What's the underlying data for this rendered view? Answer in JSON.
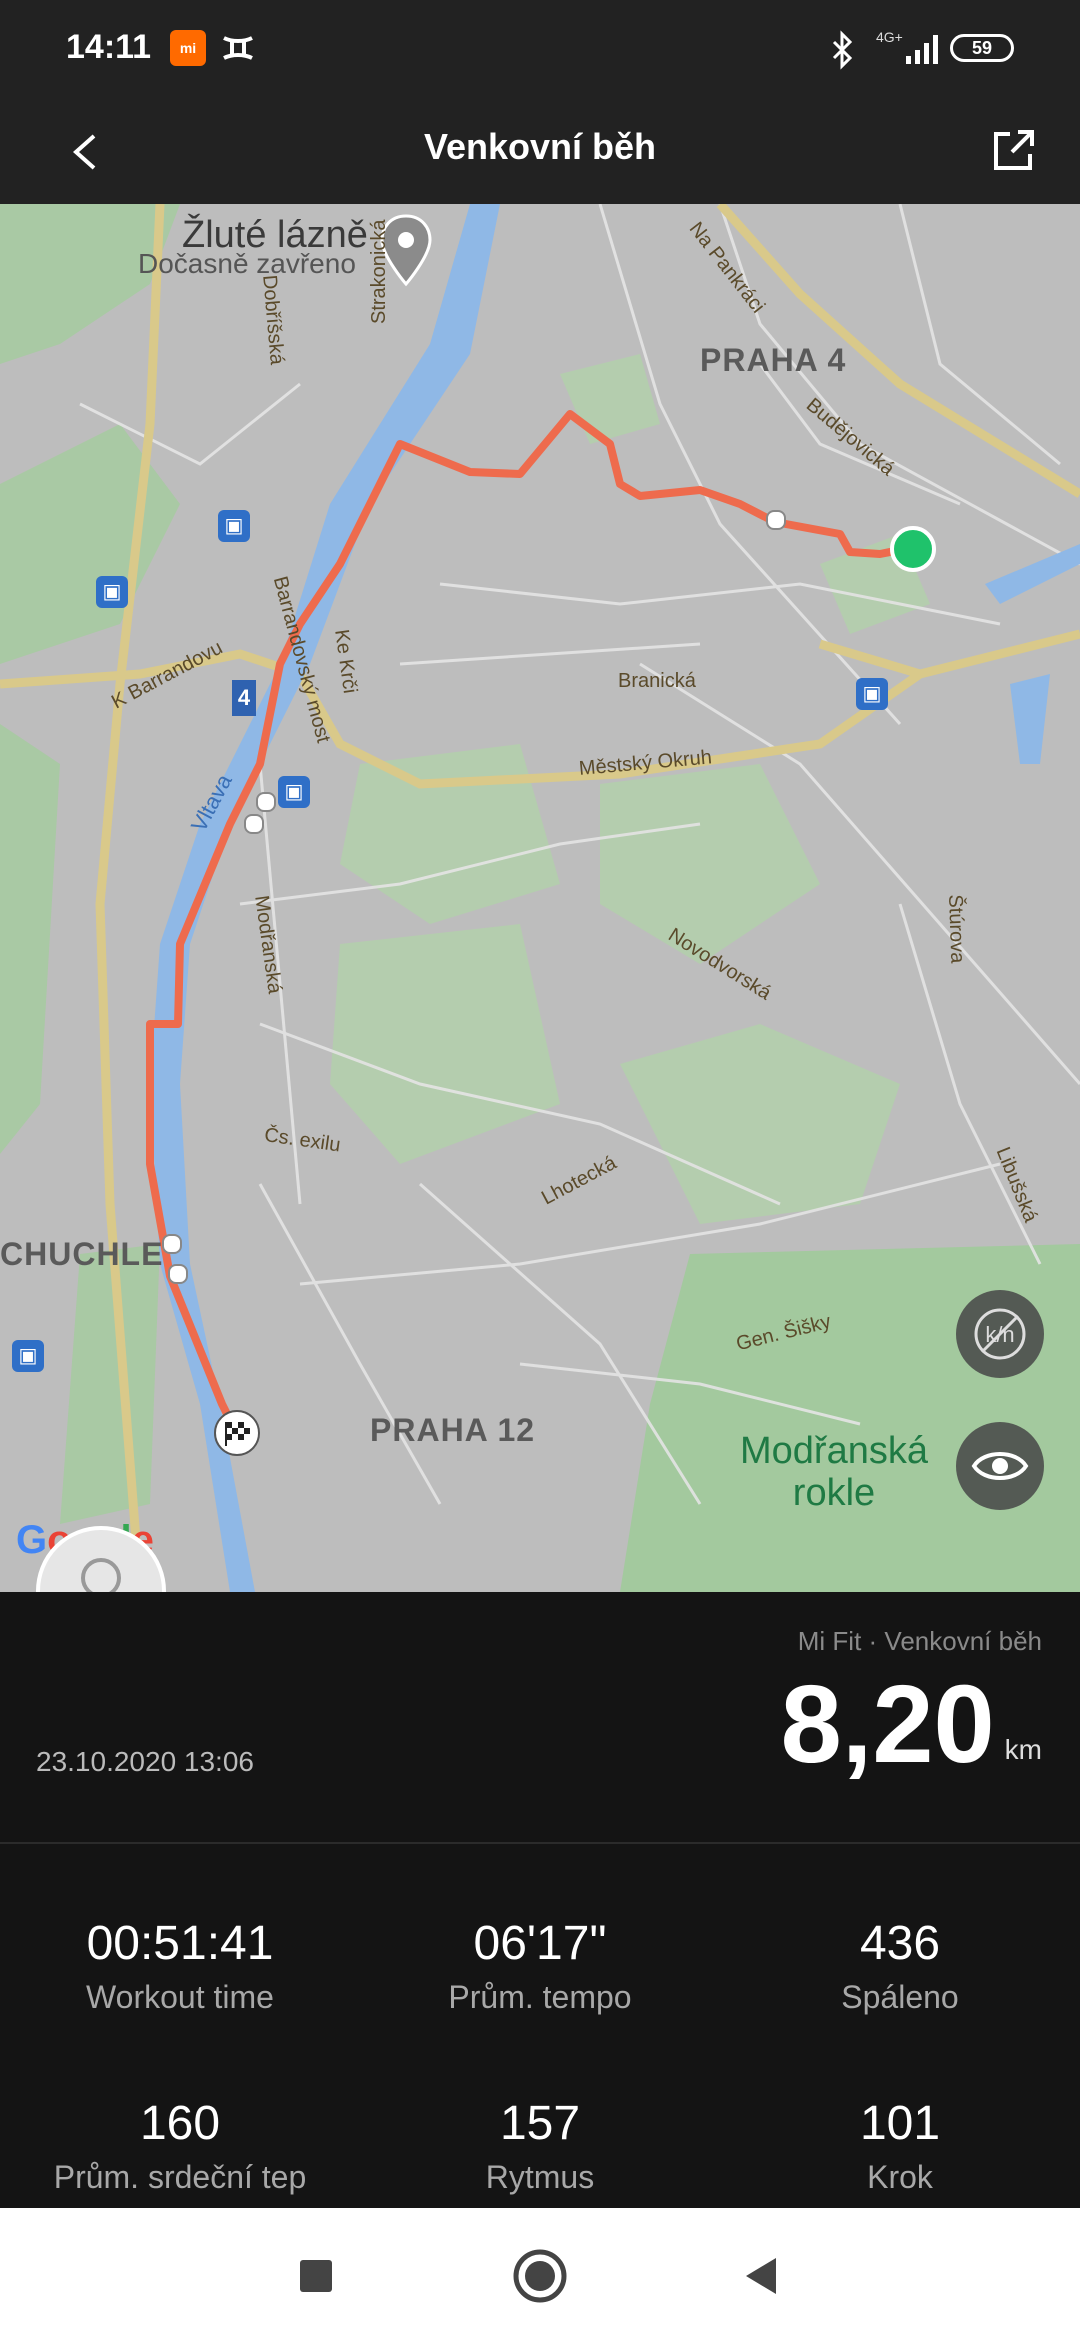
{
  "status_bar": {
    "time": "14:11",
    "network": "4G+",
    "battery": "59",
    "icons": [
      "mi-icon",
      "under-armour-icon",
      "bluetooth-icon",
      "signal-icon",
      "battery-icon"
    ]
  },
  "header": {
    "title": "Venkovní běh",
    "back_icon": "chevron-left-icon",
    "share_icon": "share-icon"
  },
  "map": {
    "poi_name": "Žluté lázně",
    "poi_status": "Dočasně zavřeno",
    "districts": [
      "PRAHA 4",
      "PRAHA 12"
    ],
    "area_label": "CHUCHLE",
    "park_line1": "Modřanská",
    "park_line2": "rokle",
    "river": "Vltava",
    "roads": [
      "Dobříšská",
      "Strakonická",
      "Na Pankráci",
      "Budějovická",
      "Barrandovský most",
      "K Barrandovu",
      "Ke Krči",
      "Branická",
      "Městský Okruh",
      "Modřanská",
      "Novodvorská",
      "Štúrova",
      "Čs. exilu",
      "Lhotecká",
      "Libušská",
      "Gen. Šišky"
    ],
    "road_number": "4",
    "google_logo": "Google",
    "buttons": [
      "unit-toggle-icon",
      "eye-icon"
    ],
    "colors": {
      "route": "#ee6b4d",
      "start_point": "#1fc26b",
      "water": "#8fb8e6",
      "park": "#9ec59a"
    }
  },
  "summary": {
    "source": "Mi Fit · Venkovní běh",
    "distance": "8,20",
    "unit": "km",
    "datetime": "23.10.2020 13:06"
  },
  "stats": [
    {
      "value": "00:51:41",
      "label": "Workout time"
    },
    {
      "value": "06'17\"",
      "label": "Prům. tempo"
    },
    {
      "value": "436",
      "label": "Spáleno"
    },
    {
      "value": "160",
      "label": "Prům. srdeční tep"
    },
    {
      "value": "157",
      "label": "Rytmus"
    },
    {
      "value": "101",
      "label": "Krok"
    }
  ],
  "nav_bar": {
    "buttons": [
      "recents-square-icon",
      "home-circle-icon",
      "back-triangle-icon"
    ]
  }
}
